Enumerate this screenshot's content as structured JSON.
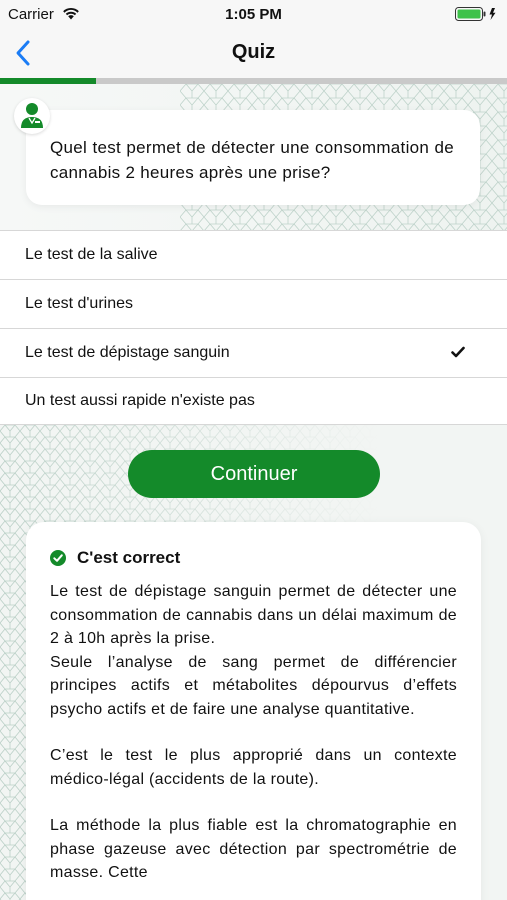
{
  "status_bar": {
    "carrier": "Carrier",
    "time": "1:05 PM"
  },
  "nav": {
    "title": "Quiz"
  },
  "progress": {
    "value": 0.19
  },
  "question": {
    "text": "Quel test permet de détecter une consommation de cannabis 2 heures après une prise?"
  },
  "answers": [
    {
      "label": "Le test de la salive",
      "selected": false
    },
    {
      "label": "Le test d'urines",
      "selected": false
    },
    {
      "label": "Le test de dépistage sanguin",
      "selected": true
    },
    {
      "label": "Un test aussi rapide n'existe pas",
      "selected": false
    }
  ],
  "continue_label": "Continuer",
  "feedback": {
    "title": "C'est correct",
    "paragraphs": [
      "Le test de dépistage sanguin permet de détecter une consommation de cannabis dans un délai maximum de 2 à 10h après la prise.\nSeule l’analyse de sang permet de différencier principes actifs et métabolites dépourvus d’effets psycho actifs et de faire une analyse quantitative.",
      "C’est le test le plus approprié dans un contexte médico-légal (accidents de la route).",
      "La méthode la plus fiable est la chromatographie en phase gazeuse avec détection par spectrométrie de masse. Cette"
    ]
  },
  "colors": {
    "accent": "#148a2a",
    "ios_blue": "#1b7cf5",
    "pattern": "#b9cfc6"
  },
  "icons": {
    "back": "chevron-left-icon",
    "wifi": "wifi-icon",
    "battery": "battery-icon",
    "avatar": "doctor-avatar-icon",
    "selected": "checkmark-icon",
    "correct": "check-circle-icon"
  }
}
